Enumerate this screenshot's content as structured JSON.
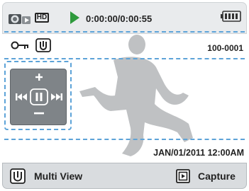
{
  "header": {
    "mode_badge": "HD",
    "time_display": "0:00:00/0:00:55"
  },
  "info_row": {
    "file_number": "100-0001"
  },
  "overlay": {
    "datetime": "JAN/01/2011 12:00AM"
  },
  "playback_controls": {
    "buttons": [
      "volume-up",
      "previous",
      "pause",
      "next",
      "volume-down"
    ]
  },
  "bottom_bar": {
    "multi_view_label": "Multi View",
    "capture_label": "Capture"
  },
  "colors": {
    "play_green": "#2e9a3c",
    "dashed_guide": "#5da3d8",
    "control_pad": "#7f8488"
  }
}
